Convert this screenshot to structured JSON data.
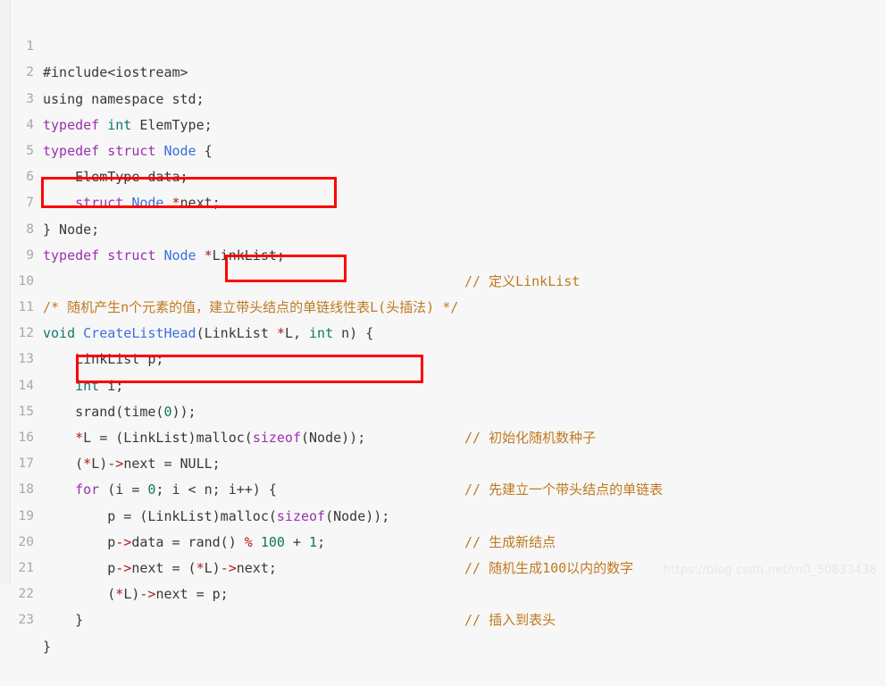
{
  "editor": {
    "language": "cpp",
    "background_color": "#f7f7f7",
    "line_number_color": "#a8a8a8",
    "first_line": 1,
    "last_line": 23,
    "colors": {
      "keyword": "#9b30b0",
      "type": "#0b7b68",
      "identifier": "#3b6fdd",
      "operator": "#b01a1a",
      "number": "#0e7a4e",
      "comment": "#bf7a20",
      "plain": "#383838",
      "annotation_box": "#ff0000"
    }
  },
  "lines": [
    {
      "n": "1",
      "code": "#include<iostream>",
      "comment": ""
    },
    {
      "n": "2",
      "code": "using namespace std;",
      "comment": ""
    },
    {
      "n": "3",
      "code": "typedef int ElemType;",
      "comment": ""
    },
    {
      "n": "4",
      "code": "typedef struct Node {",
      "comment": ""
    },
    {
      "n": "5",
      "code": "    ElemType data;",
      "comment": ""
    },
    {
      "n": "6",
      "code": "    struct Node *next;",
      "comment": ""
    },
    {
      "n": "7",
      "code": "} Node;",
      "comment": ""
    },
    {
      "n": "8",
      "code": "typedef struct Node *LinkList;",
      "comment": "// 定义LinkList"
    },
    {
      "n": "9",
      "code": "",
      "comment": ""
    },
    {
      "n": "10",
      "code": "/* 随机产生n个元素的值，建立带头结点的单链线性表L(头插法) */",
      "comment": ""
    },
    {
      "n": "11",
      "code": "void CreateListHead(LinkList *L, int n) {",
      "comment": ""
    },
    {
      "n": "12",
      "code": "    LinkList p;",
      "comment": ""
    },
    {
      "n": "13",
      "code": "    int i;",
      "comment": ""
    },
    {
      "n": "14",
      "code": "    srand(time(0));",
      "comment": "// 初始化随机数种子"
    },
    {
      "n": "15",
      "code": "    *L = (LinkList)malloc(sizeof(Node));",
      "comment": ""
    },
    {
      "n": "16",
      "code": "    (*L)->next = NULL;",
      "comment": "// 先建立一个带头结点的单链表"
    },
    {
      "n": "17",
      "code": "    for (i = 0; i < n; i++) {",
      "comment": ""
    },
    {
      "n": "18",
      "code": "        p = (LinkList)malloc(sizeof(Node));",
      "comment": "// 生成新结点"
    },
    {
      "n": "19",
      "code": "        p->data = rand() % 100 + 1;",
      "comment": "// 随机生成100以内的数字"
    },
    {
      "n": "20",
      "code": "        p->next = (*L)->next;",
      "comment": ""
    },
    {
      "n": "21",
      "code": "        (*L)->next = p;",
      "comment": "// 插入到表头"
    },
    {
      "n": "22",
      "code": "    }",
      "comment": ""
    },
    {
      "n": "23",
      "code": "}",
      "comment": ""
    }
  ],
  "comments_column": {
    "line8": "// 定义LinkList",
    "line14": "// 初始化随机数种子",
    "line16": "// 先建立一个带头结点的单链表",
    "line18": "// 生成新结点",
    "line19": "// 随机生成100以内的数字",
    "line21": "// 插入到表头"
  },
  "annotations": [
    {
      "label": "highlight-line-8-typedef-linklist",
      "target_line": "8",
      "text": "typedef struct Node *LinkList;"
    },
    {
      "label": "highlight-line-11-param-linklist-L",
      "target_line": "11",
      "text": "(LinkList *L,"
    },
    {
      "label": "highlight-line-15-malloc-assign",
      "target_line": "15",
      "text": "*L = (LinkList)malloc(sizeof(Node));"
    }
  ],
  "watermark": {
    "text": "https://blog.csdn.net/m0_50833438"
  }
}
